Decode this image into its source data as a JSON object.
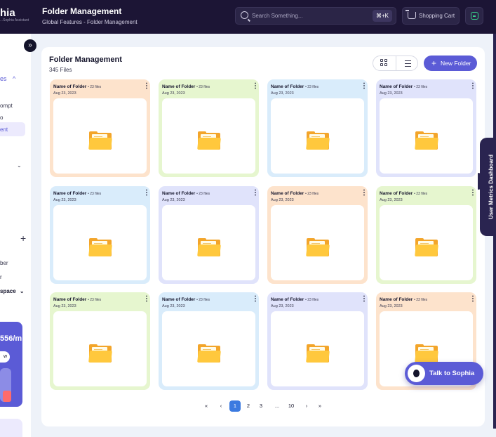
{
  "sidebar": {
    "brand": "hia",
    "brand_sub": "...Sophia Assistant",
    "collapse_glyph": "»",
    "items": [
      {
        "label": "es",
        "chevron": "^",
        "accent": true
      },
      {
        "label": "ompt"
      },
      {
        "label": "o"
      },
      {
        "label": "ent",
        "active": true
      }
    ],
    "chev_label": "⌄",
    "plus": "+",
    "lower_items": [
      {
        "label": "ber"
      },
      {
        "label": "r"
      },
      {
        "label": "space",
        "chevron": "⌄"
      }
    ],
    "promo": {
      "value": "556/m",
      "button": "w"
    }
  },
  "header": {
    "title": "Folder Management",
    "breadcrumb": "Global Features - Folder Management",
    "search": {
      "placeholder": "Search Something...",
      "shortcut": "⌘+K"
    },
    "cart_label": "Shopping Cart",
    "icons": {
      "search": "search-icon",
      "cart": "cart-icon",
      "user": "user-icon"
    }
  },
  "main": {
    "title": "Folder Management",
    "count": "345 Files",
    "new_folder_label": "New Folder",
    "new_folder_plus": "+",
    "folders": [
      {
        "name": "Name of Folder",
        "files": "• 23 files",
        "date": "Aug 23, 2023",
        "color": "#fde3cc"
      },
      {
        "name": "Name of Folder",
        "files": "• 23 files",
        "date": "Aug 23, 2023",
        "color": "#e6f6cf"
      },
      {
        "name": "Name of Folder",
        "files": "• 23 files",
        "date": "Aug 23, 2023",
        "color": "#d9ecfb"
      },
      {
        "name": "Name of Folder",
        "files": "• 23 files",
        "date": "Aug 23, 2023",
        "color": "#e0e3fb"
      },
      {
        "name": "Name of Folder",
        "files": "• 23 files",
        "date": "Aug 23, 2023",
        "color": "#d9ecfb"
      },
      {
        "name": "Name of Folder",
        "files": "• 23 files",
        "date": "Aug 23, 2023",
        "color": "#e0e3fb"
      },
      {
        "name": "Name of Folder",
        "files": "• 23 files",
        "date": "Aug 23, 2023",
        "color": "#fde3cc"
      },
      {
        "name": "Name of Folder",
        "files": "• 23 files",
        "date": "Aug 23, 2023",
        "color": "#e6f6cf"
      },
      {
        "name": "Name of Folder",
        "files": "• 23 files",
        "date": "Aug 23, 2023",
        "color": "#e6f6cf"
      },
      {
        "name": "Name of Folder",
        "files": "• 23 files",
        "date": "Aug 23, 2023",
        "color": "#d9ecfb"
      },
      {
        "name": "Name of Folder",
        "files": "• 23 files",
        "date": "Aug 23, 2023",
        "color": "#e0e3fb"
      },
      {
        "name": "Name of Folder",
        "files": "• 23 files",
        "date": "Aug 23, 2023",
        "color": "#fde3cc"
      }
    ],
    "kebab": "⋮"
  },
  "pagination": {
    "first": "«",
    "prev": "‹",
    "pages": [
      "1",
      "2",
      "3",
      "...",
      "10"
    ],
    "current": "1",
    "next": "›",
    "last": "»"
  },
  "side_tab": {
    "label": "User Metrics Dashboard"
  },
  "assistant": {
    "label": "Talk to Sophia"
  },
  "colors": {
    "accent": "#5b5bd6",
    "header_bg": "#1c1535",
    "page_bg": "#eef2f9",
    "active_page": "#3b7ae0",
    "folder_icon": "#ffc83d"
  }
}
